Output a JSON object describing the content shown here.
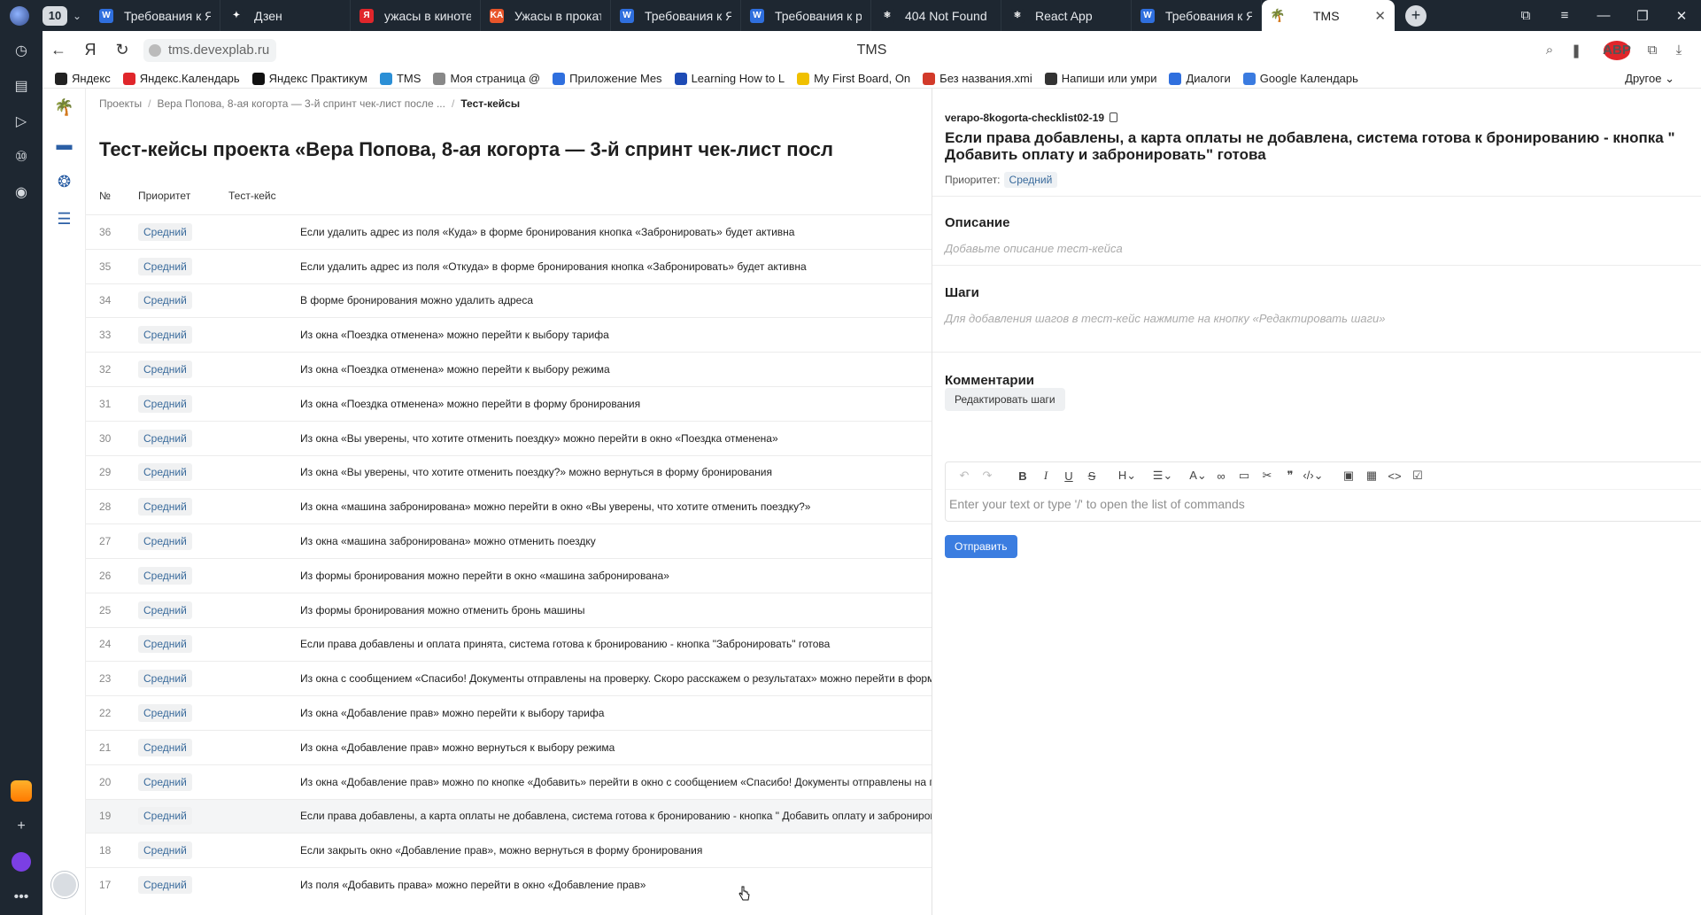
{
  "browser": {
    "tab_count": "10",
    "tabs": [
      {
        "title": "Требования к Янд",
        "fav": "W",
        "color": "#2f6fde"
      },
      {
        "title": "Дзен",
        "fav": "✦",
        "color": "#1e2731"
      },
      {
        "title": "ужасы в кинотеа",
        "fav": "Я",
        "color": "#e0262b"
      },
      {
        "title": "Ужасы в прокате",
        "fav": "KA",
        "color": "#e8552a"
      },
      {
        "title": "Требования к Янд",
        "fav": "W",
        "color": "#2f6fde"
      },
      {
        "title": "Требования к рас",
        "fav": "W",
        "color": "#2f6fde"
      },
      {
        "title": "404 Not Found",
        "fav": "⚛",
        "color": "#1e2731"
      },
      {
        "title": "React App",
        "fav": "⚛",
        "color": "#1e2731"
      },
      {
        "title": "Требования к Янд",
        "fav": "W",
        "color": "#2f6fde"
      }
    ],
    "active_tab": {
      "title": "TMS",
      "fav": "🌴"
    },
    "url": "tms.devexplab.ru",
    "page_title": "TMS",
    "bookmarks": [
      {
        "label": "Яндекс",
        "color": "#222"
      },
      {
        "label": "Яндекс.Календарь",
        "color": "#e0262b"
      },
      {
        "label": "Яндекс Практикум",
        "color": "#111"
      },
      {
        "label": "TMS",
        "color": "#2b8fd6"
      },
      {
        "label": "Моя страница @",
        "color": "#888"
      },
      {
        "label": "Приложение Mes",
        "color": "#2f6fde"
      },
      {
        "label": "Learning How to L",
        "color": "#1e4bb5"
      },
      {
        "label": "My First Board, On",
        "color": "#f0c000"
      },
      {
        "label": "Без названия.xmi",
        "color": "#d23a2a"
      },
      {
        "label": "Напиши или умри",
        "color": "#333"
      },
      {
        "label": "Диалоги",
        "color": "#2f6fde"
      },
      {
        "label": "Google Календарь",
        "color": "#3a7be0"
      }
    ],
    "bookmarks_other": "Другое"
  },
  "breadcrumb": {
    "items": [
      "Проекты",
      "Вера Попова, 8-ая когорта — 3-й спринт чек-лист после ..."
    ],
    "current": "Тест-кейсы"
  },
  "page": {
    "heading": "Тест-кейсы проекта «Вера Попова, 8-ая когорта — 3-й спринт чек-лист посл",
    "columns": {
      "num": "№",
      "priority": "Приоритет",
      "case": "Тест-кейс"
    }
  },
  "rows": [
    {
      "num": "36",
      "priority": "Средний",
      "title": "Если удалить адрес из поля «Куда» в форме бронирования кнопка «Забронировать» будет активна"
    },
    {
      "num": "35",
      "priority": "Средний",
      "title": "Если удалить адрес из поля «Откуда» в форме бронирования кнопка «Забронировать» будет активна"
    },
    {
      "num": "34",
      "priority": "Средний",
      "title": "В форме бронирования можно удалить адреса"
    },
    {
      "num": "33",
      "priority": "Средний",
      "title": "Из окна «Поездка отменена» можно перейти к выбору тарифа"
    },
    {
      "num": "32",
      "priority": "Средний",
      "title": "Из окна «Поездка отменена» можно перейти к выбору режима"
    },
    {
      "num": "31",
      "priority": "Средний",
      "title": "Из окна «Поездка отменена» можно перейти в форму бронирования"
    },
    {
      "num": "30",
      "priority": "Средний",
      "title": "Из окна «Вы уверены, что хотите отменить поездку» можно перейти в окно «Поездка отменена»"
    },
    {
      "num": "29",
      "priority": "Средний",
      "title": "Из окна «Вы уверены, что хотите отменить поездку?» можно вернуться в форму бронирования"
    },
    {
      "num": "28",
      "priority": "Средний",
      "title": "Из окна «машина забронирована» можно перейти в окно «Вы уверены, что хотите отменить поездку?»"
    },
    {
      "num": "27",
      "priority": "Средний",
      "title": "Из окна «машина забронирована» можно отменить поездку"
    },
    {
      "num": "26",
      "priority": "Средний",
      "title": "Из формы бронирования можно перейти в окно «машина забронирована»"
    },
    {
      "num": "25",
      "priority": "Средний",
      "title": "Из формы бронирования можно отменить бронь машины"
    },
    {
      "num": "24",
      "priority": "Средний",
      "title": "Если права добавлены и оплата принята, система готова к бронированию - кнопка \"Забронировать\" готова"
    },
    {
      "num": "23",
      "priority": "Средний",
      "title": "Из окна с сообщением «Спасибо! Документы отправлены на проверку. Скоро расскажем о результатах» можно перейти в форму б"
    },
    {
      "num": "22",
      "priority": "Средний",
      "title": "Из окна «Добавление прав» можно перейти к выбору тарифа"
    },
    {
      "num": "21",
      "priority": "Средний",
      "title": "Из окна «Добавление прав» можно вернуться к выбору режима"
    },
    {
      "num": "20",
      "priority": "Средний",
      "title": "Из окна «Добавление прав» можно по кнопке «Добавить» перейти в окно с сообщением «Спасибо! Документы отправлены на про"
    },
    {
      "num": "19",
      "priority": "Средний",
      "title": "Если права добавлены, а карта оплаты не добавлена, система готова к бронированию - кнопка \" Добавить оплату и забронировать"
    },
    {
      "num": "18",
      "priority": "Средний",
      "title": "Если закрыть окно «Добавление прав», можно вернуться в форму бронирования"
    },
    {
      "num": "17",
      "priority": "Средний",
      "title": "Из поля «Добавить права» можно перейти в окно «Добавление прав»"
    }
  ],
  "selected_row": "19",
  "detail": {
    "code": "verapo-8kogorta-checklist02-19",
    "title": "Если права добавлены, а карта оплаты не добавлена, система готова к бронированию - кнопка \" Добавить оплату и забронировать\" готова",
    "priority_label": "Приоритет:",
    "priority_value": "Средний",
    "description_heading": "Описание",
    "description_placeholder": "Добавьте описание тест-кейса",
    "steps_heading": "Шаги",
    "steps_placeholder": "Для добавления шагов в тест-кейс нажмите на кнопку «Редактировать шаги»",
    "edit_steps_button": "Редактировать шаги",
    "comments_heading": "Комментарии",
    "editor_placeholder": "Enter your text or type '/' to open the list of commands",
    "send_button": "Отправить"
  }
}
